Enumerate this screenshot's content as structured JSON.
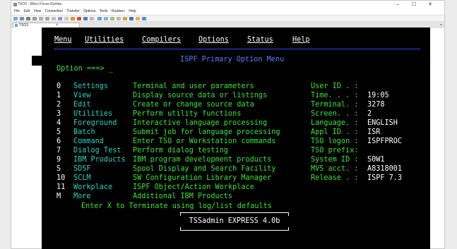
{
  "window": {
    "title": "TSO3 - Micro Focus Rumba",
    "minimize": "–",
    "maximize": "☐",
    "close": "✕"
  },
  "app_menu": [
    "File",
    "Edit",
    "View",
    "Connection",
    "Transfer",
    "Options",
    "Tools",
    "Rumba+",
    "Help"
  ],
  "session_tab": {
    "label": "TSO3",
    "close": "×"
  },
  "action_bar": [
    "Menu",
    "Utilities",
    "Compilers",
    "Options",
    "Status",
    "Help"
  ],
  "panel_title": "ISPF Primary Option Menu",
  "option_prompt": "Option ===> _",
  "options": [
    {
      "key": "0",
      "name": "Settings",
      "desc": "Terminal and user parameters"
    },
    {
      "key": "1",
      "name": "View",
      "desc": "Display source data or listings"
    },
    {
      "key": "2",
      "name": "Edit",
      "desc": "Create or change source data"
    },
    {
      "key": "3",
      "name": "Utilities",
      "desc": "Perform utility functions"
    },
    {
      "key": "4",
      "name": "Foreground",
      "desc": "Interactive language processing"
    },
    {
      "key": "5",
      "name": "Batch",
      "desc": "Submit job for language processing"
    },
    {
      "key": "6",
      "name": "Command",
      "desc": "Enter TSO or Workstation commands"
    },
    {
      "key": "7",
      "name": "Dialog Test",
      "desc": "Perform dialog testing"
    },
    {
      "key": "9",
      "name": "IBM Products",
      "desc": "IBM program development products"
    },
    {
      "key": "S",
      "name": "SDSF",
      "desc": "Spool Display and Search Facility"
    },
    {
      "key": "10",
      "name": "SCLM",
      "desc": "SW Configuration Library Manager"
    },
    {
      "key": "11",
      "name": "Workplace",
      "desc": "ISPF Object/Action Workplace"
    },
    {
      "key": "M",
      "name": "More",
      "desc": "Additional IBM Products"
    }
  ],
  "info": [
    {
      "label": "User ID . :",
      "value": ""
    },
    {
      "label": "Time. . . :",
      "value": "19:05"
    },
    {
      "label": "Terminal. :",
      "value": "3278"
    },
    {
      "label": "Screen. . :",
      "value": "2"
    },
    {
      "label": "Language. :",
      "value": "ENGLISH"
    },
    {
      "label": "Appl ID . :",
      "value": "ISR"
    },
    {
      "label": "TSO logon :",
      "value": "ISPFPROC"
    },
    {
      "label": "TSO prefix:",
      "value": ""
    },
    {
      "label": "System ID :",
      "value": "S0W1"
    },
    {
      "label": "MVS acct. :",
      "value": "A8318001"
    },
    {
      "label": "Release . :",
      "value": "ISPF 7.3"
    }
  ],
  "exit_hint": "Enter X to Terminate using log/list defaults",
  "popup_text": "TSSadmin EXPRESS 4.0b",
  "colors": {
    "terminal_bg": "#000000",
    "field": "#26d6c3",
    "input": "#35e835",
    "title": "#5f7bff"
  }
}
